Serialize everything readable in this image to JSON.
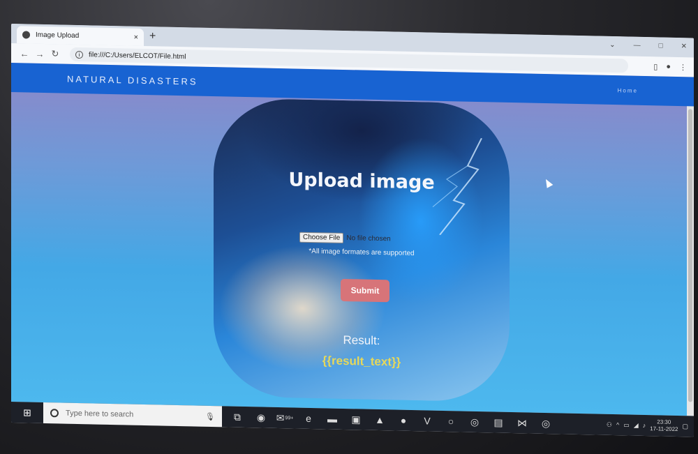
{
  "browser": {
    "tab_title": "Image Upload",
    "tab_close": "×",
    "new_tab": "+",
    "address": "file:///C:/Users/ELCOT/File.html",
    "window_controls": [
      "⌄",
      "—",
      "□",
      "✕"
    ]
  },
  "navbar": {
    "brand": "NATURAL DISASTERS",
    "home": "Home"
  },
  "card": {
    "title": "Upload image",
    "file_button": "Choose File",
    "file_status": "No file chosen",
    "hint": "*All image formates are supported",
    "submit": "Submit",
    "result_label": "Result:",
    "result_text": "{{result_text}}"
  },
  "taskbar": {
    "search_placeholder": "Type here to search",
    "mail_badge": "99+",
    "time": "23:30",
    "date": "17-11-2022"
  },
  "colors": {
    "navbar": "#1863d2",
    "submit": "#d77479",
    "result_text": "#e6d85a"
  }
}
